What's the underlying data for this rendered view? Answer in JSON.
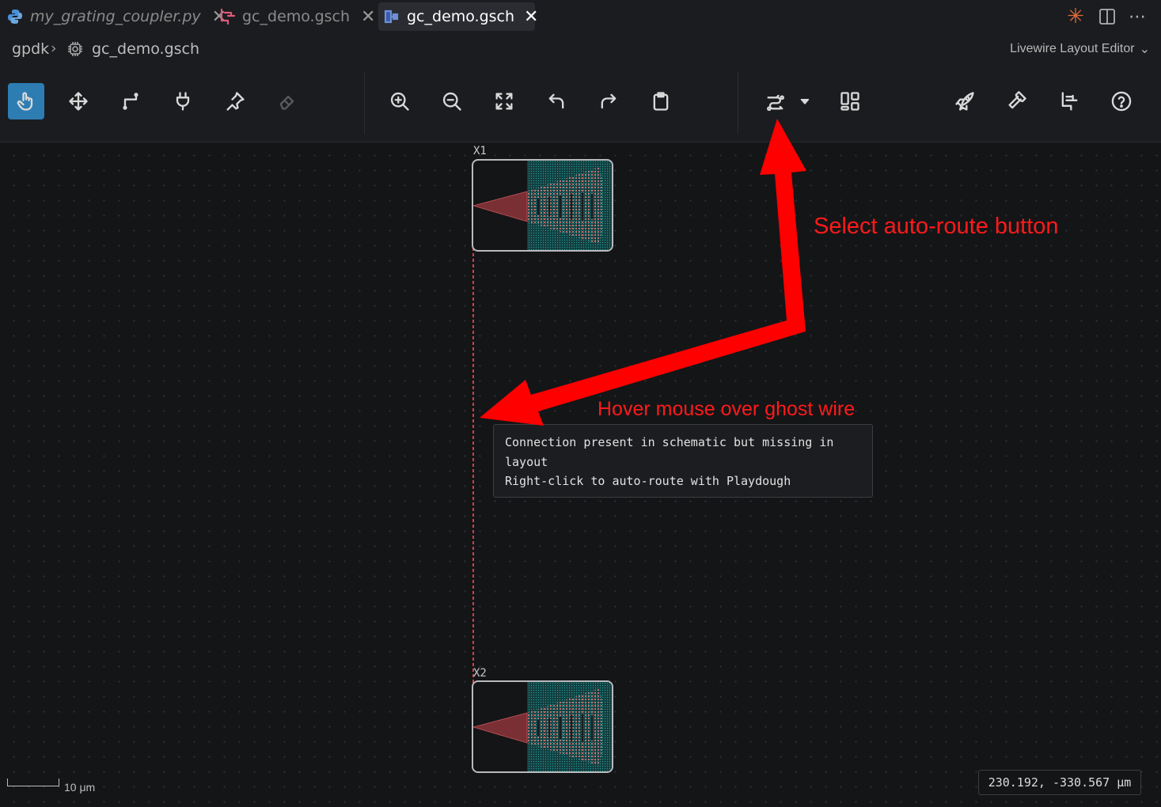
{
  "tabs": [
    {
      "label": "my_grating_coupler.py",
      "icon": "python-icon"
    },
    {
      "label": "gc_demo.gsch",
      "icon": "schematic-icon"
    },
    {
      "label": "gc_demo.gsch",
      "icon": "layout-icon",
      "active": true
    }
  ],
  "breadcrumb": {
    "folder": "gpdk",
    "file": "gc_demo.gsch"
  },
  "editor_mode": "Livewire Layout Editor",
  "toolbar": {
    "groups": [
      [
        "select-tool",
        "move-tool",
        "route-tool",
        "port-tool",
        "pin-tool",
        "erase-tool"
      ],
      [
        "zoom-in",
        "zoom-out",
        "fit-view",
        "undo",
        "redo",
        "clipboard"
      ],
      [
        "auto-route",
        "auto-route-menu",
        "layout-panels"
      ],
      [
        "run",
        "build",
        "schematic",
        "help"
      ]
    ]
  },
  "instances": [
    {
      "name": "X1"
    },
    {
      "name": "X2"
    }
  ],
  "tooltip": {
    "line1": "Connection present in schematic but missing in",
    "line2": "layout",
    "line3": "Right-click to auto-route with Playdough"
  },
  "annotations": {
    "autoroute": "Select auto-route button",
    "hover": "Hover mouse over ghost wire",
    "color": "#ff1a1a"
  },
  "status": {
    "coordinates": "230.192, -330.567 μm",
    "scale": "10 μm"
  },
  "colors": {
    "accent": "#2d7db3",
    "ghost_wire": "#d0404a",
    "device_fill": "#e3706f",
    "device_bg": "#16504f"
  }
}
